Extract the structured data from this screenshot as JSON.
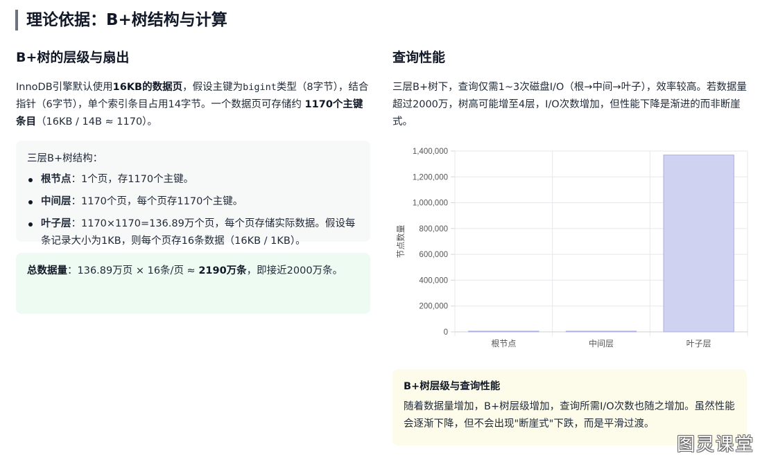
{
  "page": {
    "title": "理论依据：B+树结构与计算"
  },
  "left": {
    "heading": "B+树的层级与扇出",
    "intro": {
      "p1": "InnoDB引擎默认使用",
      "b1": "16KB的数据页",
      "p2": "，假设主键为",
      "code": "bigint",
      "p3": "类型（8字节），结合指针（6字节），单个索引条目占用14字节。一个数据页可存储约 ",
      "b2": "1170个主键条目",
      "p4": "（16KB / 14B ≈ 1170）。"
    },
    "structure": {
      "title": "三层B+树结构：",
      "items": [
        {
          "label": "根节点",
          "text": "：1个页，存1170个主键。"
        },
        {
          "label": "中间层",
          "text": "：1170个页，每个页存1170个主键。"
        },
        {
          "label": "叶子层",
          "text": "：1170×1170=136.89万个页，每个页存储实际数据。假设每条记录大小为1KB，则每个页存16条数据（16KB / 1KB）。"
        }
      ]
    },
    "total": {
      "label": "总数据量",
      "p1": "：136.89万页 × 16条/页 ≈ ",
      "b1": "2190万条",
      "p2": "，即接近2000万条。"
    }
  },
  "right": {
    "heading": "查询性能",
    "intro": "三层B+树下，查询仅需1~3次磁盘I/O（根→中间→叶子），效率较高。若数据量超过2000万，树高可能增至4层，I/O次数增加，但性能下降是渐进的而非断崖式。",
    "note": {
      "title": "B+树层级与查询性能",
      "body": "随着数据量增加，B+树层级增加，查询所需I/O次数也随之增加。虽然性能会逐渐下降，但不会出现\"断崖式\"下跌，而是平滑过渡。"
    }
  },
  "chart_data": {
    "type": "bar",
    "categories": [
      "根节点",
      "中间层",
      "叶子层"
    ],
    "values": [
      1,
      1170,
      1368900
    ],
    "ylabel": "节点数量",
    "xlabel": "",
    "ylim": [
      0,
      1400000
    ],
    "yticks": [
      0,
      200000,
      400000,
      600000,
      800000,
      1000000,
      1200000,
      1400000
    ],
    "bar_color": "#cfd2f1",
    "bar_border": "#a9addf",
    "grid": true
  },
  "watermark": "图灵课堂"
}
